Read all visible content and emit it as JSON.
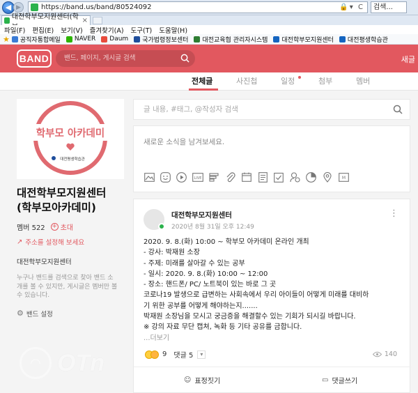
{
  "browser": {
    "url": "https://band.us/band/80524092",
    "search_placeholder": "검색...",
    "tab_title": "대전학부모지원센터(학부...",
    "menu": [
      "파일(F)",
      "편집(E)",
      "보기(V)",
      "즐겨찾기(A)",
      "도구(T)",
      "도움말(H)"
    ],
    "favorites": [
      {
        "label": "공직자통합메일",
        "color": "#3a7bd5"
      },
      {
        "label": "NAVER",
        "color": "#2db400"
      },
      {
        "label": "Daum",
        "color": "#e84b3c"
      },
      {
        "label": "국가법령정보센터",
        "color": "#1f4e9c"
      },
      {
        "label": "대전교육협 관리자시스템",
        "color": "#2e7d32"
      },
      {
        "label": "대전학부모지원센터",
        "color": "#1565c0"
      },
      {
        "label": "대전평생학습관",
        "color": "#1565c0"
      }
    ]
  },
  "header": {
    "logo": "BAND",
    "search_placeholder": "밴드, 페이지, 게시글 검색",
    "right_text": "새글"
  },
  "tabs": [
    {
      "label": "전체글",
      "active": true
    },
    {
      "label": "사진첩",
      "active": false
    },
    {
      "label": "일정",
      "active": false
    },
    {
      "label": "첨부",
      "active": false
    },
    {
      "label": "멤버",
      "active": false
    }
  ],
  "sidebar": {
    "cover_text": "학부모 아카데미",
    "cover_subtext": "대전평생학습관",
    "band_name_line1": "대전학부모지원센터",
    "band_name_line2": "(학부모아카데미)",
    "members": "멤버 522",
    "invite": "초대",
    "address_link": "주소를 설정해 보세요",
    "title": "대전학부모지원센터",
    "desc_line1": "누구나 밴드를 검색으로 찾아 밴드 소",
    "desc_line2": "개를 볼 수 있지만, 게시글은 멤버만 볼",
    "desc_line3": "수 있습니다.",
    "settings": "밴드 설정"
  },
  "main": {
    "post_search_placeholder": "글 내용, #태그, @작성자 검색",
    "composer_placeholder": "새로운 소식을 남겨보세요.",
    "composer_tools": [
      "image-icon",
      "emoji-icon",
      "video-icon",
      "live-icon",
      "poll-icon",
      "attach-icon",
      "calendar-icon",
      "checklist-icon",
      "todo-icon",
      "money-icon",
      "quiz-icon",
      "location-icon",
      "mail-icon"
    ]
  },
  "post": {
    "author": "대전학부모지원센터",
    "date": "2020년 8월 31일 오후 12:49",
    "lines": [
      "2020. 9. 8.(화) 10:00 ~  학부모 아카데미 온라인 개최",
      "- 강사: 박재원 소장",
      "- 주제: 미래를 살아갈 수 있는 공부",
      "- 일시: 2020. 9. 8.(화) 10:00 ~ 12:00",
      "- 장소: 핸드폰/ PC/ 노트북이 있는 바로 그 곳",
      "코로나19 발생으로 급변하는 사회속에서 우리 아이들이 어떻게 미래를 대비하",
      "기 위한 공부를 어떻게 해야하는지.......",
      " 박재원 소장님을 모시고 궁금증을 해결할수 있는 기회가 되시길 바랍니다.",
      "※ 강의 자료 무단 캡쳐, 녹화 등 기타 공유를 금합니다."
    ],
    "more": "...더보기",
    "reaction_count": "9",
    "comment_count": "댓글 5",
    "views": "140",
    "action_react": "표정짓기",
    "action_comment": "댓글쓰기"
  },
  "watermark": {
    "text": "OTn"
  },
  "colors": {
    "band_red": "#e2585f",
    "online_green": "#2bb24c"
  }
}
